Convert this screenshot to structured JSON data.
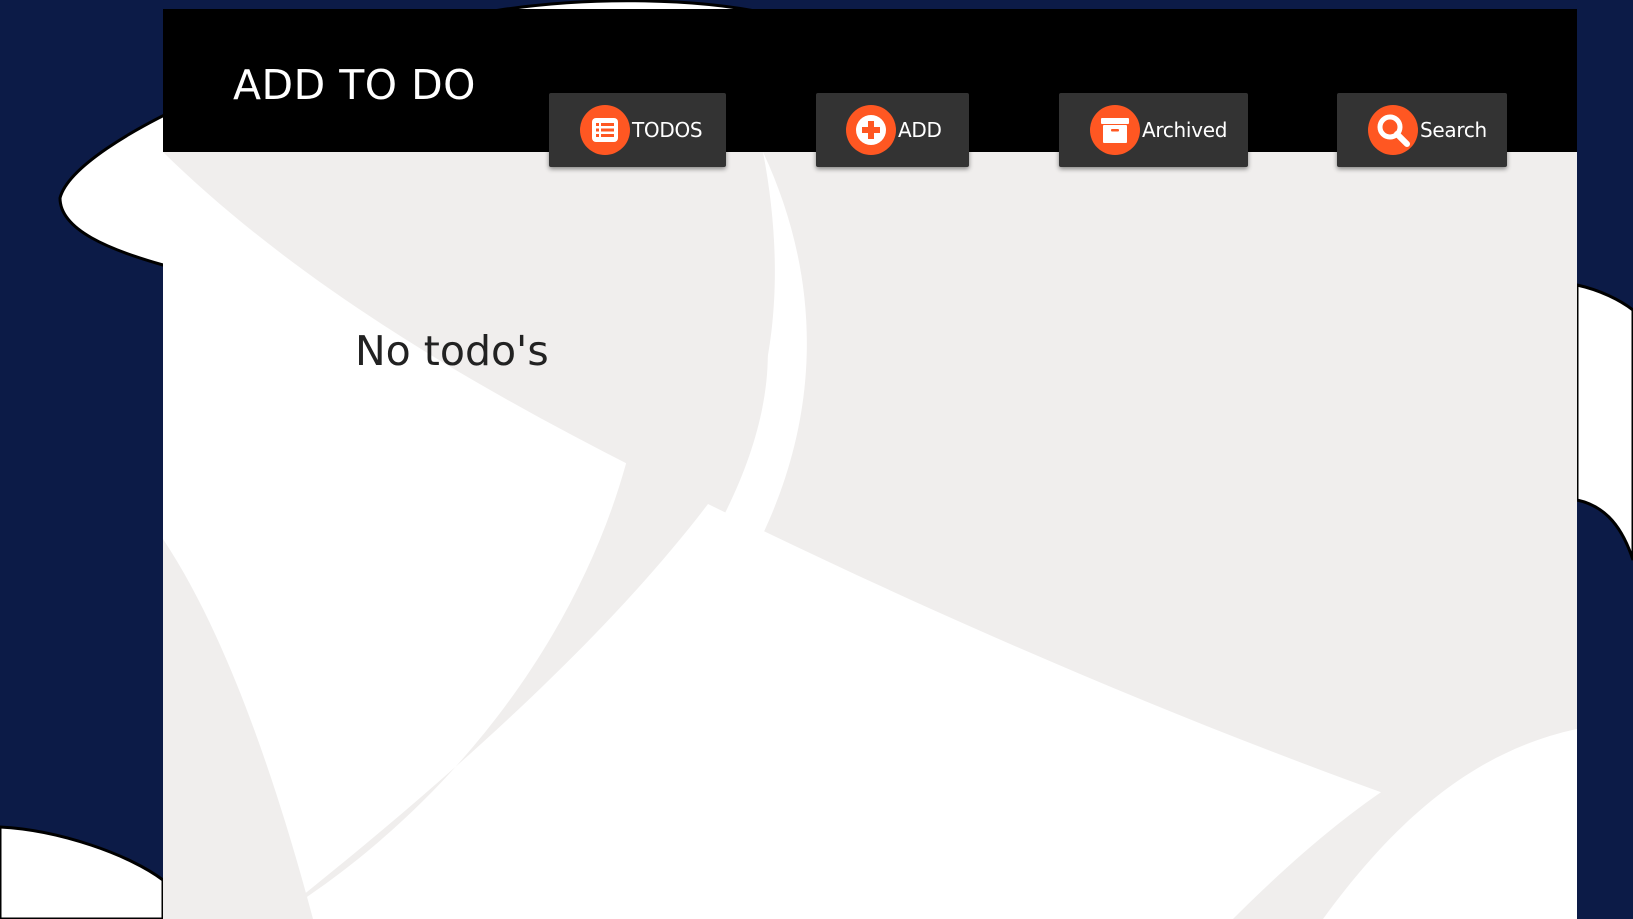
{
  "app": {
    "title": "ADD TO DO"
  },
  "nav": {
    "todos": {
      "label": "TODOS",
      "icon": "list-icon"
    },
    "add": {
      "label": "ADD",
      "icon": "plus-circle-icon"
    },
    "archived": {
      "label": "Archived",
      "icon": "archive-icon"
    },
    "search": {
      "label": "Search",
      "icon": "search-icon"
    }
  },
  "main": {
    "empty_message": "No todo's"
  },
  "colors": {
    "accent": "#ff5722",
    "header_bg": "#000000",
    "button_bg": "#333333",
    "page_bg": "#0c1b47",
    "content_bg": "#f0eeed"
  }
}
